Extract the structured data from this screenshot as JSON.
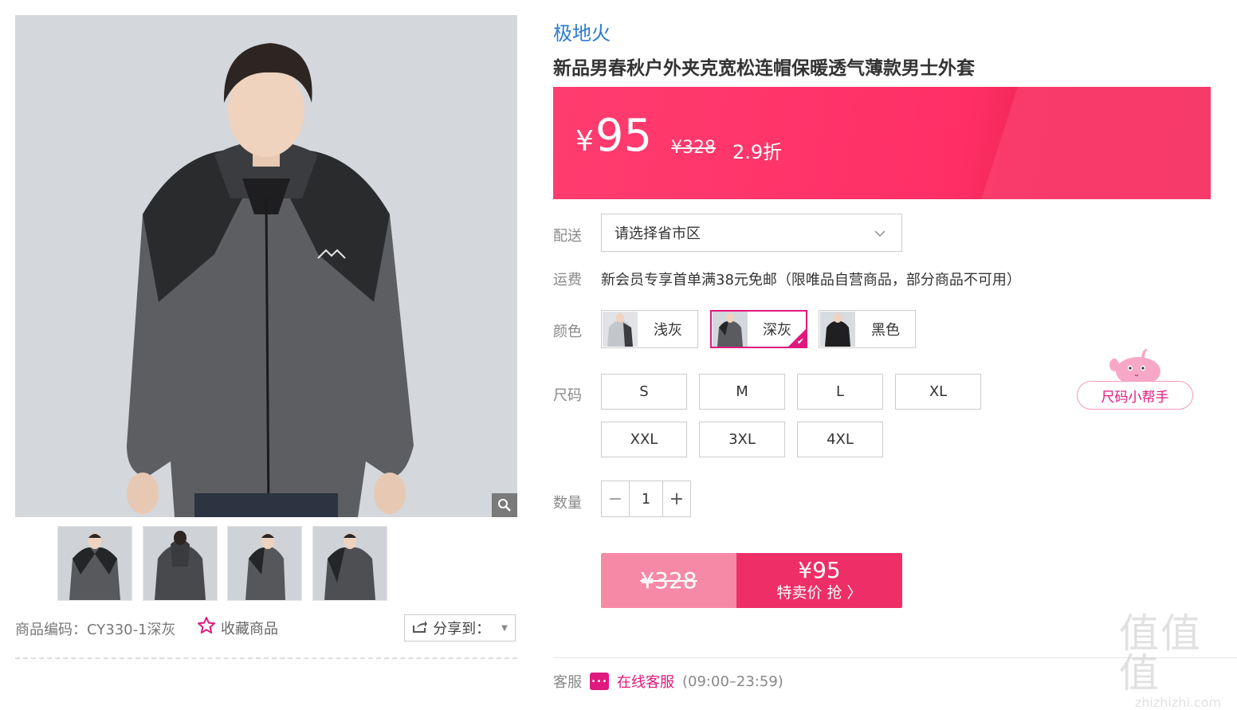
{
  "product": {
    "brand": "极地火",
    "title": "新品男春秋户外夹克宽松连帽保暖透气薄款男士外套",
    "sku_code": "商品编码：CY330-1深灰",
    "favorite_label": "收藏商品",
    "share_label": "分享到："
  },
  "price": {
    "symbol": "¥",
    "current": "95",
    "original": "¥328",
    "discount": "2.9折"
  },
  "delivery": {
    "label": "配送",
    "placeholder": "请选择省市区"
  },
  "shipping": {
    "label": "运费",
    "text": "新会员专享首单满38元免邮（限唯品自营商品，部分商品不可用）"
  },
  "colors": {
    "label": "颜色",
    "options": [
      {
        "name": "浅灰",
        "swatch": "#c9ccd0"
      },
      {
        "name": "深灰",
        "swatch": "#5a5b5e"
      },
      {
        "name": "黑色",
        "swatch": "#1f1f21"
      }
    ],
    "selected": "深灰",
    "accent": "#e0197e"
  },
  "sizes": {
    "label": "尺码",
    "options": [
      "S",
      "M",
      "L",
      "XL",
      "XXL",
      "3XL",
      "4XL"
    ],
    "helper": "尺码小帮手"
  },
  "quantity": {
    "label": "数量",
    "value": "1",
    "minus": "−",
    "plus": "+"
  },
  "buy": {
    "original": "¥328",
    "price": "¥95",
    "cta": "特卖价 抢 〉"
  },
  "service": {
    "label": "客服",
    "link": "在线客服",
    "hours": "(09:00–23:59)"
  },
  "watermark": {
    "logo": "值值值",
    "url": "zhizhizhi.com"
  },
  "colors_theme": {
    "price_bar": "#ff2f66",
    "brand_link": "#2a7bd0"
  }
}
